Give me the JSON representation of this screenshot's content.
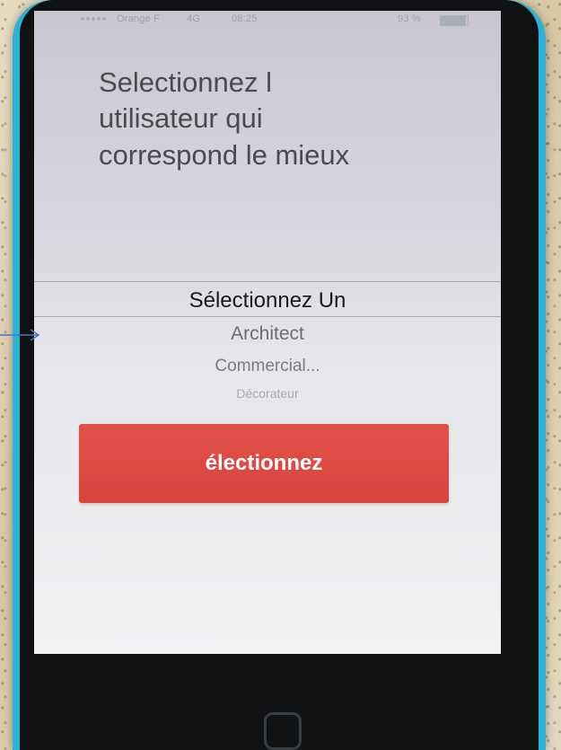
{
  "status_bar": {
    "carrier": "Orange F",
    "network": "4G",
    "time": "08:25",
    "battery_percent": "93 %",
    "battery_level": 0.93
  },
  "screen": {
    "title": "Selectionnez l\nutilisateur qui\ncorrespond le mieux",
    "picker": {
      "selected": "Sélectionnez Un",
      "options": [
        "Architect",
        "Commercial...",
        "Décorateur"
      ]
    },
    "button_label": "électionnez"
  },
  "colors": {
    "phone_case": "#2bb2d6",
    "button": "#d9443d",
    "annotation_arrow": "#4a74c4"
  },
  "icons": [
    "signal-dots-icon",
    "battery-icon",
    "annotation-arrow-icon"
  ]
}
